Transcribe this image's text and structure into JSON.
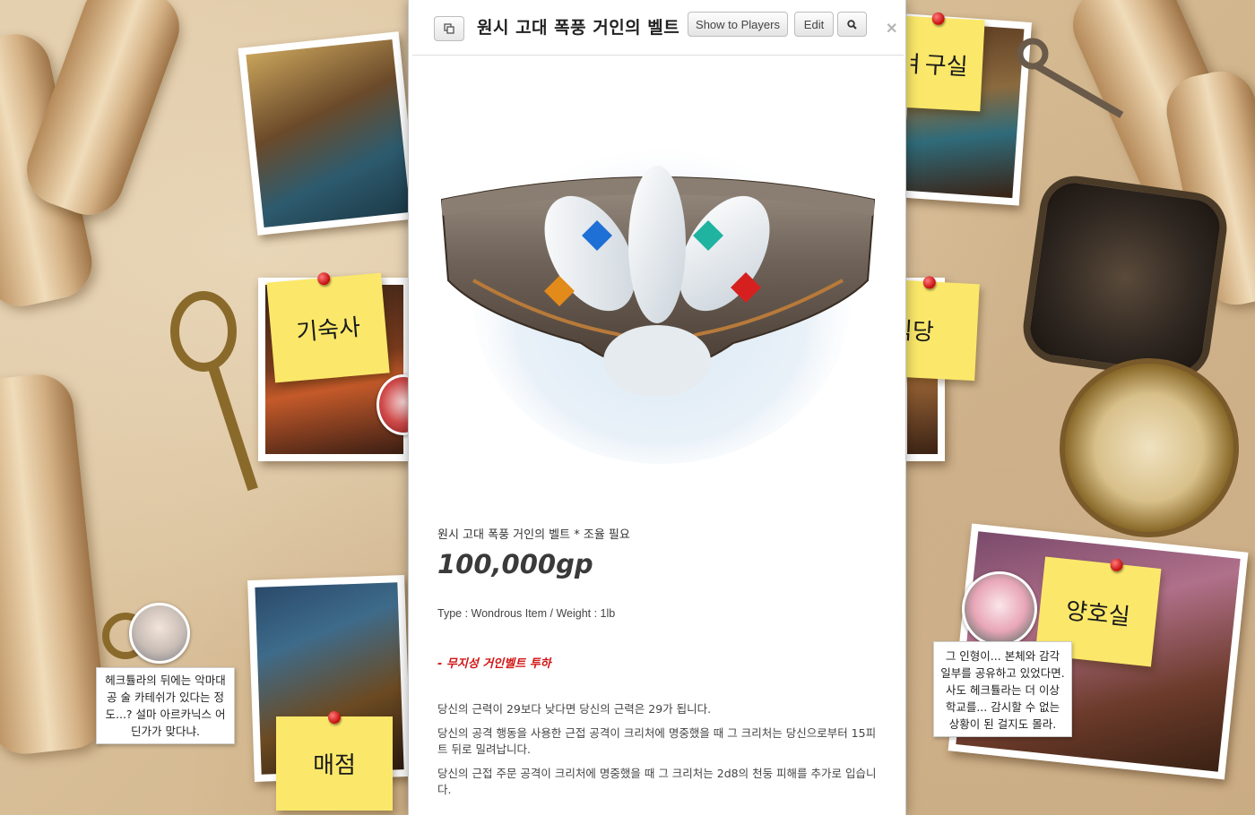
{
  "dialog": {
    "title": "원시 고대 폭풍 거인의 벨트",
    "buttons": {
      "show_to_players": "Show to Players",
      "edit": "Edit"
    },
    "icons": {
      "popout": "popout-icon",
      "search": "search-icon",
      "close": "close-icon"
    },
    "item": {
      "subtitle": "원시 고대 폭풍 거인의 벨트 * 조율 필요",
      "price": "100,000gp",
      "type_line": "Type : Wondrous Item / Weight : 1lb",
      "warning": "- 무지성 거인벨트 투하",
      "description": [
        "당신의 근력이 29보다 낮다면 당신의 근력은 29가 됩니다.",
        "당신의 공격 행동을 사용한 근접 공격이 크리처에 명중했을 때 그 크리처는 당신으로부터 15피트 뒤로 밀려납니다.",
        "당신의 근접 주문 공격이 크리처에 명중했을 때 그 크리처는 2d8의 천둥 피해를 추가로 입습니다."
      ]
    }
  },
  "background": {
    "notes": {
      "dormitory": "기숙사",
      "shop": "매점",
      "infirmary": "양호실",
      "lab_partial": "ㅕ구실",
      "dining_partial": "식당"
    },
    "speech_left": "헤크튤라의 뒤에는 악마대공 술 카테쉬가 있다는 정도...? 설마 아르카닉스 어딘가가 맞다냐.",
    "speech_right": "그 인형이... 본체와 감각 일부를 공유하고 있었다면. 사도 헤크튤라는 더 이상 학교를... 감시할 수 없는 상황이 된 걸지도 몰라."
  },
  "colors": {
    "warning": "#d21515",
    "note_yellow": "#fbe86a",
    "parchment": "#d9c4a3"
  }
}
